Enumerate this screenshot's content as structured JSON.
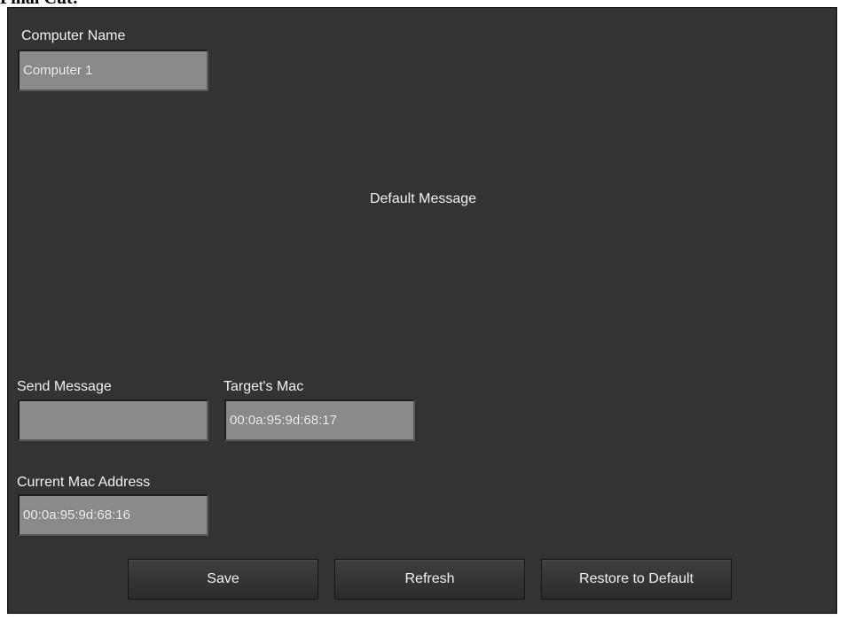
{
  "page": {
    "title": "Final Cut:"
  },
  "computer_name": {
    "label": "Computer Name",
    "value": "Computer 1"
  },
  "message": {
    "text": "Default Message"
  },
  "send_message": {
    "label": "Send Message",
    "value": ""
  },
  "target_mac": {
    "label": "Target's Mac",
    "value": "00:0a:95:9d:68:17"
  },
  "current_mac": {
    "label": "Current Mac Address",
    "value": "00:0a:95:9d:68:16"
  },
  "buttons": {
    "save": "Save",
    "refresh": "Refresh",
    "restore": "Restore to Default"
  }
}
